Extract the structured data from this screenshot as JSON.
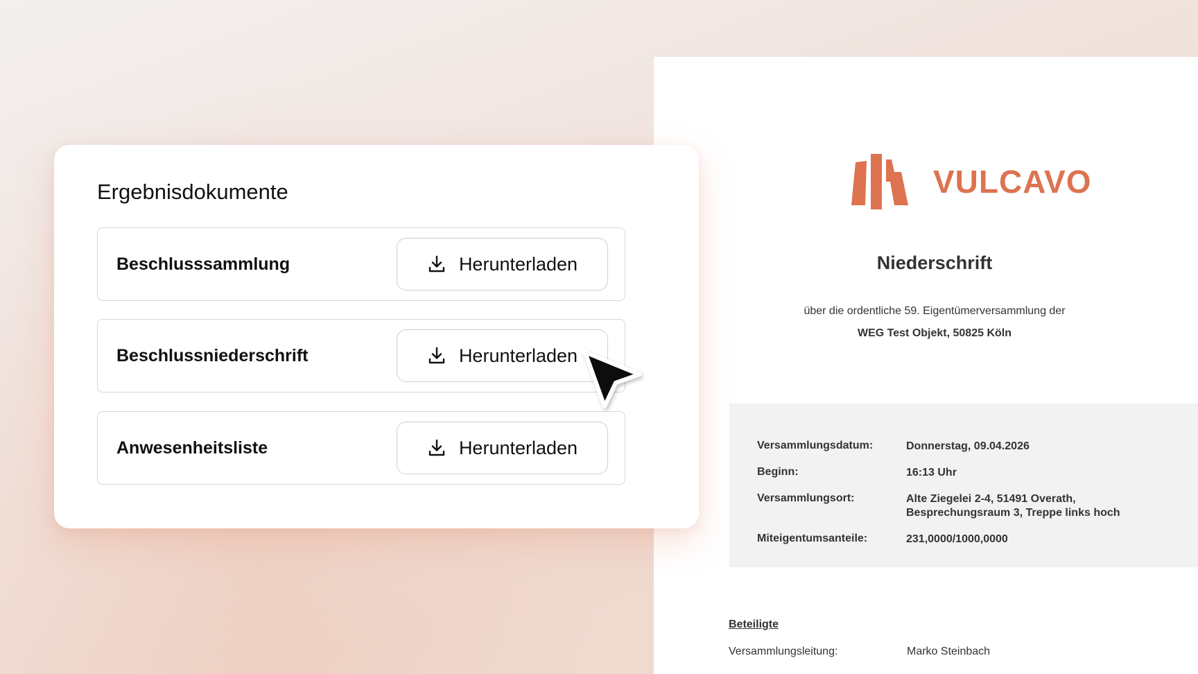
{
  "card": {
    "title": "Ergebnisdokumente",
    "rows": [
      {
        "label": "Beschlusssammlung",
        "button_label": "Herunterladen"
      },
      {
        "label": "Beschlussniederschrift",
        "button_label": "Herunterladen"
      },
      {
        "label": "Anwesenheitsliste",
        "button_label": "Herunterladen"
      }
    ],
    "button_icon": "download-icon"
  },
  "document": {
    "brand": "VULCAVO",
    "brand_color": "#dd7350",
    "title": "Niederschrift",
    "intro": "über die ordentliche 59. Eigentümerversammlung der",
    "object": "WEG Test Objekt, 50825 Köln",
    "details": [
      {
        "key": "Versammlungsdatum:",
        "value": "Donnerstag, 09.04.2026"
      },
      {
        "key": "Beginn:",
        "value": "16:13 Uhr"
      },
      {
        "key": "Versammlungsort:",
        "value": "Alte Ziegelei 2-4, 51491 Overath,",
        "value2": "Besprechungsraum 3, Treppe links hoch"
      },
      {
        "key": "Miteigentumsanteile:",
        "value": "231,0000/1000,0000"
      }
    ],
    "section_title": "Beteiligte",
    "participants": [
      {
        "role": "Versammlungsleitung:",
        "name": "Marko Steinbach"
      }
    ]
  },
  "cursor_icon": "arrow-cursor-icon"
}
